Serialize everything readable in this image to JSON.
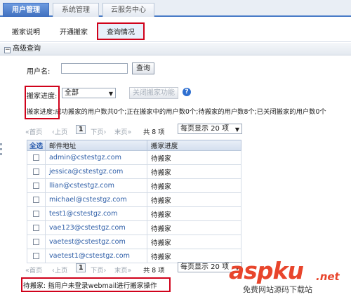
{
  "top_tabs": [
    {
      "label": "用户管理",
      "active": true
    },
    {
      "label": "系统管理",
      "active": false
    },
    {
      "label": "云服务中心",
      "active": false
    }
  ],
  "sub_tabs": [
    {
      "label": "搬家说明"
    },
    {
      "label": "开通搬家"
    },
    {
      "label": "查询情况",
      "active": true
    }
  ],
  "section": {
    "toggle": "−",
    "title": "高级查询"
  },
  "search": {
    "username_label": "用户名:",
    "username_value": "",
    "query_button": "查询"
  },
  "filter": {
    "progress_label": "搬家进度:",
    "progress_selected": "全部",
    "close_button": "关闭搬家功能",
    "help": "?"
  },
  "status": {
    "label": "搬家进度:",
    "text": "成功搬家的用户数共0个;正在搬家中的用户数0个;待搬家的用户数8个;已关闭搬家的用户数0个"
  },
  "pager": {
    "first": "«首页",
    "prev": "‹上页",
    "page": "1",
    "next": "下页›",
    "last": "末页»",
    "total": "共 8 项",
    "per_page": "每页显示 20 项"
  },
  "table": {
    "headers": {
      "select": "全选",
      "email": "邮件地址",
      "progress": "搬家进度"
    },
    "rows": [
      {
        "email": "admin@cstestgz.com",
        "progress": "待搬家"
      },
      {
        "email": "jessica@cstestgz.com",
        "progress": "待搬家"
      },
      {
        "email": "llian@cstestgz.com",
        "progress": "待搬家"
      },
      {
        "email": "michael@cstestgz.com",
        "progress": "待搬家"
      },
      {
        "email": "test1@cstestgz.com",
        "progress": "待搬家"
      },
      {
        "email": "vae123@cstestgz.com",
        "progress": "待搬家"
      },
      {
        "email": "vaetest@cstestgz.com",
        "progress": "待搬家"
      },
      {
        "email": "vaetest1@cstestgz.com",
        "progress": "待搬家"
      }
    ]
  },
  "footer_note": "待搬家: 指用户未登录webmail进行搬家操作",
  "watermark": {
    "main_a": "asp",
    "main_b": "ku",
    "dotnet": ".net",
    "sub": "免费网站源码下载站"
  },
  "colors": {
    "accent": "#4a7cc7",
    "highlight": "#d0021b",
    "link": "#2f5fa8",
    "watermark": "#e8452c"
  }
}
